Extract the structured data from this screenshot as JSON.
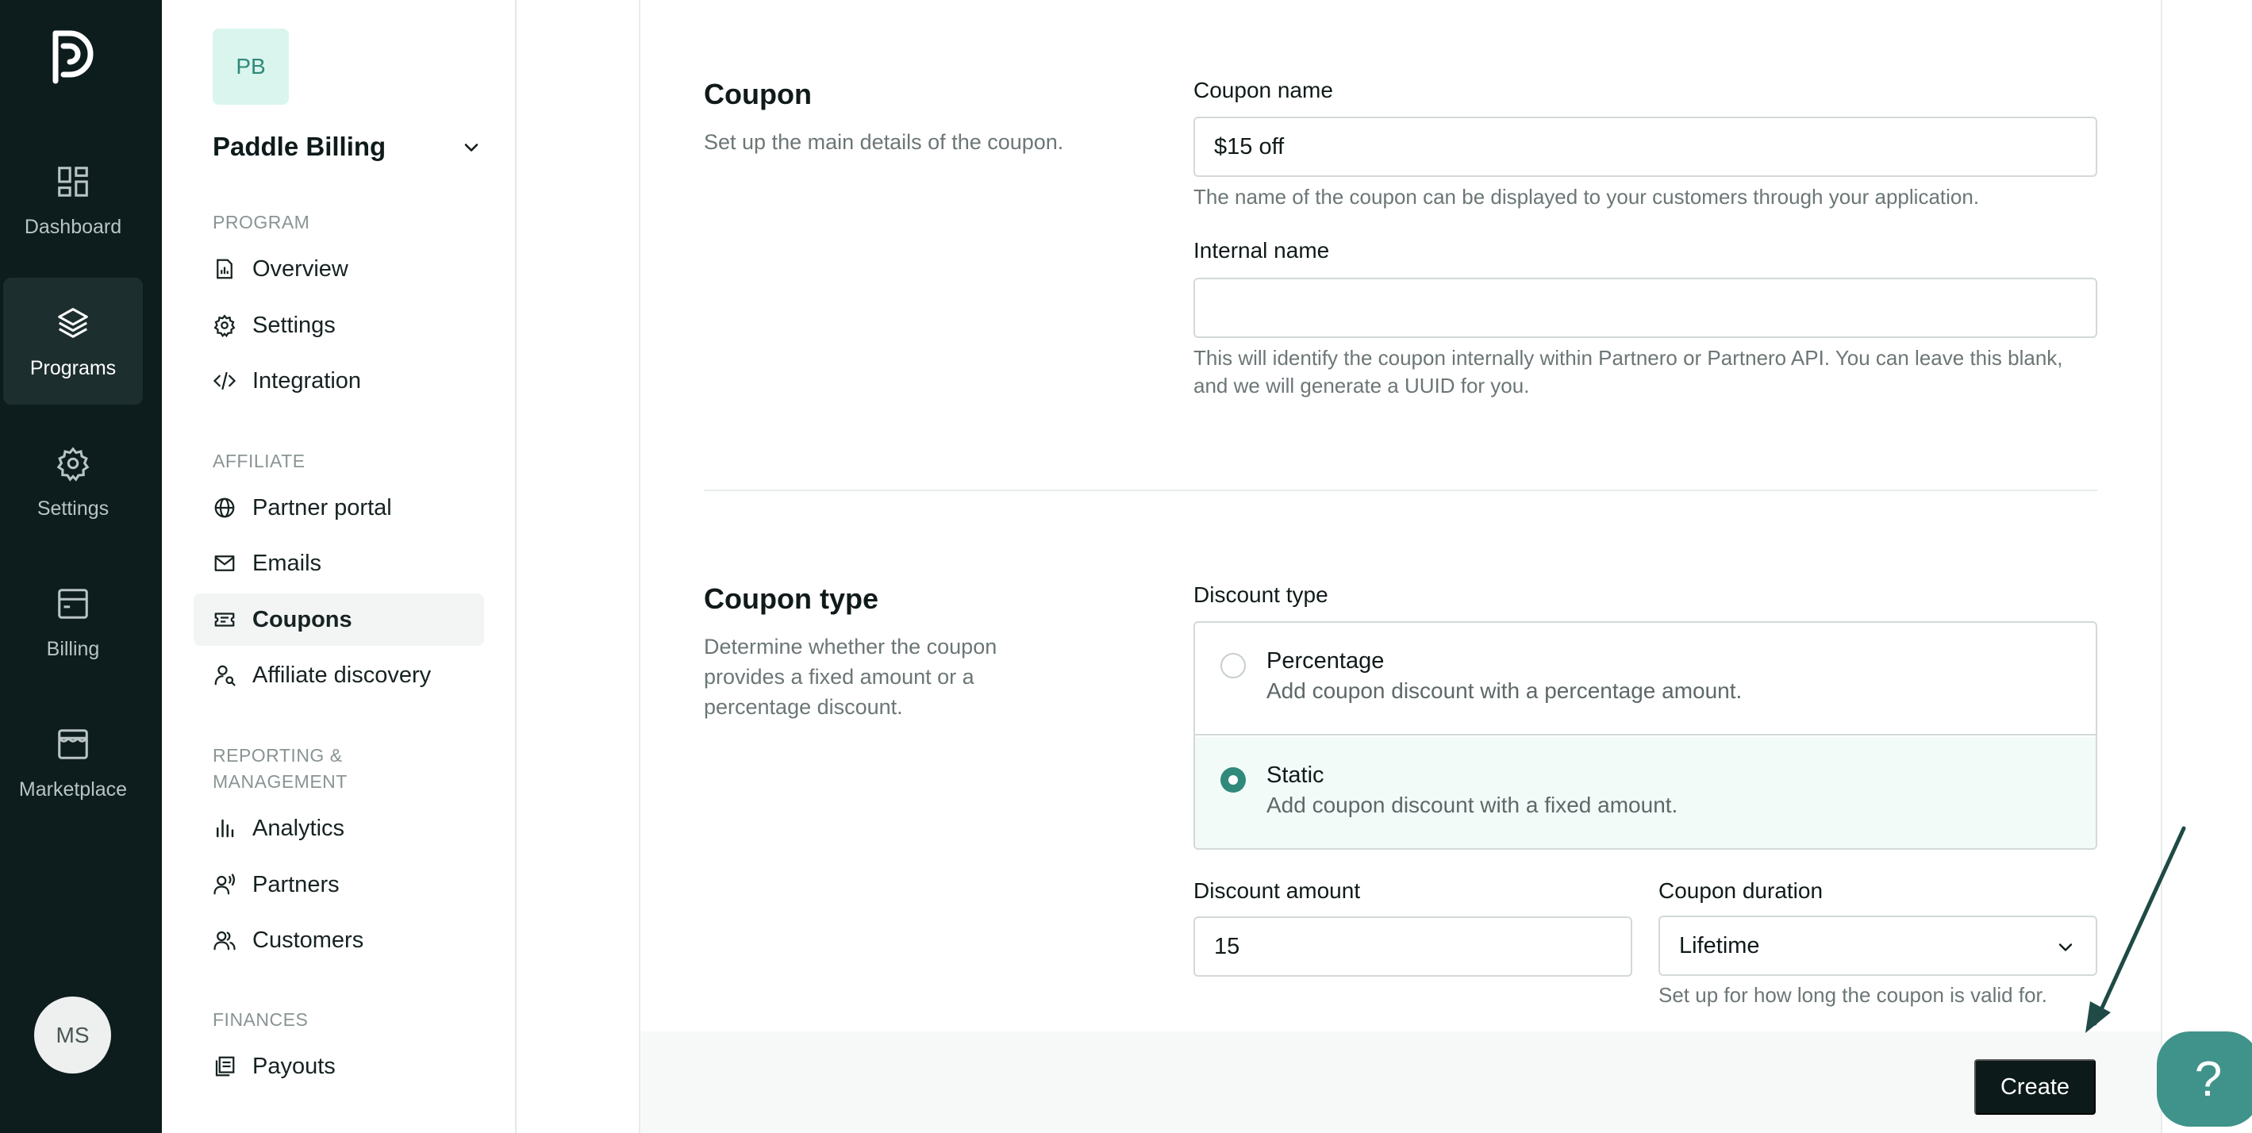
{
  "rail": {
    "items": [
      {
        "label": "Dashboard",
        "icon": "dashboard-icon",
        "active": false
      },
      {
        "label": "Programs",
        "icon": "layers-icon",
        "active": true
      },
      {
        "label": "Settings",
        "icon": "gear-icon",
        "active": false
      },
      {
        "label": "Billing",
        "icon": "billing-icon",
        "active": false
      },
      {
        "label": "Marketplace",
        "icon": "store-icon",
        "active": false
      }
    ],
    "avatar": "MS"
  },
  "sidebar": {
    "avatar": "PB",
    "title": "Paddle Billing",
    "sections": [
      {
        "heading": "PROGRAM",
        "items": [
          {
            "label": "Overview",
            "icon": "report-icon"
          },
          {
            "label": "Settings",
            "icon": "gear-icon"
          },
          {
            "label": "Integration",
            "icon": "code-icon"
          }
        ]
      },
      {
        "heading": "AFFILIATE",
        "items": [
          {
            "label": "Partner portal",
            "icon": "globe-icon"
          },
          {
            "label": "Emails",
            "icon": "mail-icon"
          },
          {
            "label": "Coupons",
            "icon": "ticket-icon",
            "active": true
          },
          {
            "label": "Affiliate discovery",
            "icon": "user-search-icon"
          }
        ]
      },
      {
        "heading": "REPORTING &",
        "heading2": "MANAGEMENT",
        "items": [
          {
            "label": "Analytics",
            "icon": "bar-chart-icon"
          },
          {
            "label": "Partners",
            "icon": "user-voice-icon"
          },
          {
            "label": "Customers",
            "icon": "users-icon"
          }
        ]
      },
      {
        "heading": "FINANCES",
        "items": [
          {
            "label": "Payouts",
            "icon": "receipt-icon"
          }
        ]
      }
    ]
  },
  "coupon": {
    "title": "Coupon",
    "description": "Set up the main details of the coupon.",
    "name_label": "Coupon name",
    "name_value": "$15 off",
    "name_hint": "The name of the coupon can be displayed to your customers through your application.",
    "internal_label": "Internal name",
    "internal_value": "",
    "internal_hint": "This will identify the coupon internally within Partnero or Partnero API. You can leave this blank, and we will generate a UUID for you."
  },
  "coupon_type": {
    "title": "Coupon type",
    "description": "Determine whether the coupon provides a fixed amount or a percentage discount.",
    "discount_type_label": "Discount type",
    "options": [
      {
        "title": "Percentage",
        "subtitle": "Add coupon discount with a percentage amount.",
        "selected": false
      },
      {
        "title": "Static",
        "subtitle": "Add coupon discount with a fixed amount.",
        "selected": true
      }
    ],
    "amount_label": "Discount amount",
    "amount_value": "15",
    "duration_label": "Coupon duration",
    "duration_value": "Lifetime",
    "duration_hint": "Set up for how long the coupon is valid for."
  },
  "footer": {
    "create_label": "Create"
  },
  "help": {
    "label": "?"
  },
  "colors": {
    "accent": "#2f8a7a",
    "rail_bg": "#0d1c1c",
    "button_bg": "#0d1a1a",
    "arrow": "#1f4a46"
  }
}
